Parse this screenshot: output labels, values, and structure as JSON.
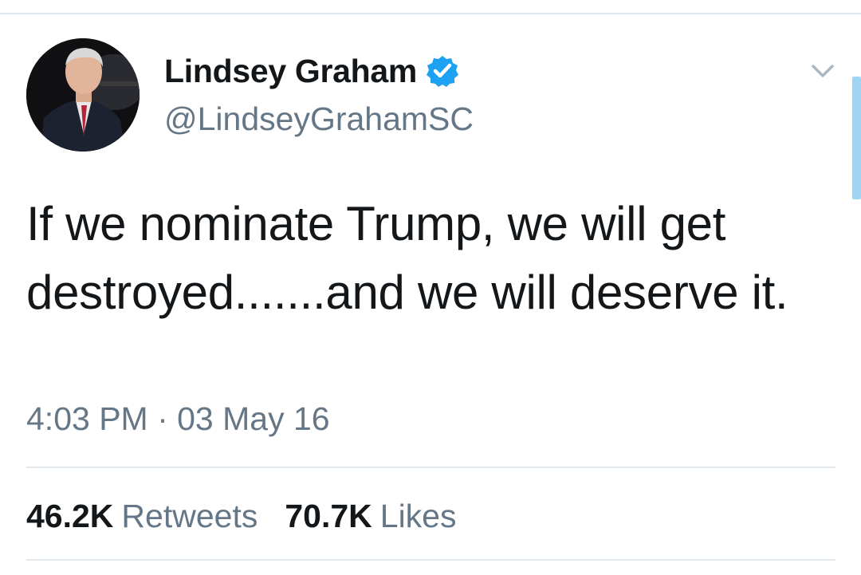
{
  "tweet": {
    "author": {
      "display_name": "Lindsey Graham",
      "handle": "@LindseyGrahamSC",
      "verified": true,
      "verified_icon": "verified-badge-icon",
      "avatar_alt": "profile photo"
    },
    "text": "If we nominate Trump, we will get destroyed.......and we will deserve it.",
    "timestamp": "4:03 PM · 03 May 16",
    "stats": {
      "retweets_count": "46.2K",
      "retweets_label": "Retweets",
      "likes_count": "70.7K",
      "likes_label": "Likes"
    },
    "menu_icon": "chevron-down-icon"
  },
  "colors": {
    "primary_text": "#14171a",
    "secondary_text": "#657786",
    "verified_blue": "#1da1f2",
    "divider": "#e1e8ed",
    "scrollbar": "#9fd4f5"
  }
}
